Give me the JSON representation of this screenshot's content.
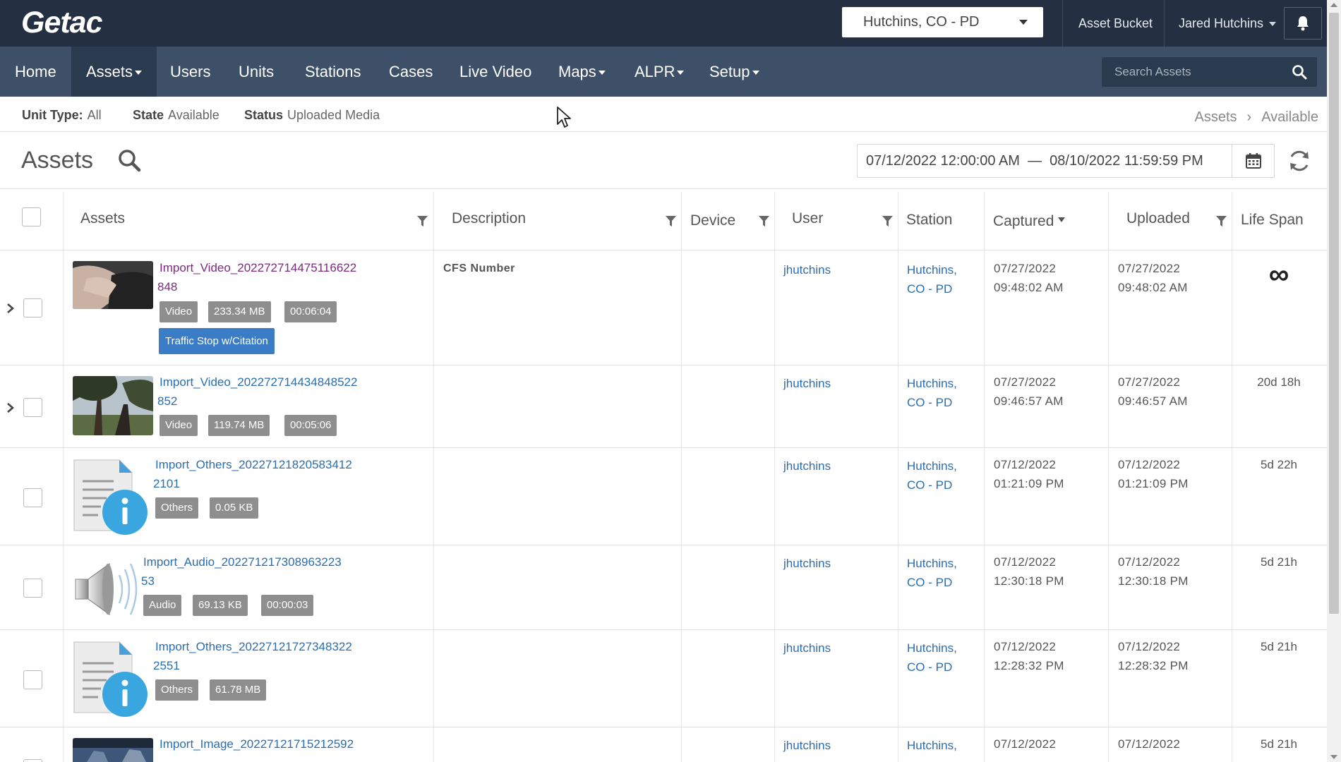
{
  "header": {
    "logo": "Getac",
    "agency": "Hutchins, CO - PD",
    "asset_bucket": "Asset Bucket",
    "user_name": "Jared Hutchins"
  },
  "nav": {
    "items": [
      "Home",
      "Assets",
      "Users",
      "Units",
      "Stations",
      "Cases",
      "Live Video",
      "Maps",
      "ALPR",
      "Setup"
    ],
    "active": "Assets",
    "search_placeholder": "Search Assets"
  },
  "filters": {
    "unit_type_label": "Unit Type:",
    "unit_type_value": "All",
    "state_label": "State",
    "state_value": "Available",
    "status_label": "Status",
    "status_value": "Uploaded Media",
    "breadcrumb": [
      "Assets",
      "Available"
    ]
  },
  "page": {
    "title": "Assets",
    "date_range": "07/12/2022 12:00:00 AM  —  08/10/2022 11:59:59 PM"
  },
  "columns": [
    "Assets",
    "Description",
    "Device",
    "User",
    "Station",
    "Captured",
    "Uploaded",
    "Life Span"
  ],
  "rows": [
    {
      "name_line1": "Import_Video_202272714475116622",
      "name_line2": "848",
      "type": "Video",
      "size": "233.34 MB",
      "duration": "00:06:04",
      "category": "Traffic Stop w/Citation",
      "description": "CFS Number",
      "user": "jhutchins",
      "station_line1": "Hutchins,",
      "station_line2": "CO - PD",
      "captured_date": "07/27/2022",
      "captured_time": "09:48:02 AM",
      "uploaded_date": "07/27/2022",
      "uploaded_time": "09:48:02 AM",
      "life_span": "∞"
    },
    {
      "name_line1": "Import_Video_202272714434848522",
      "name_line2": "852",
      "type": "Video",
      "size": "119.74 MB",
      "duration": "00:05:06",
      "user": "jhutchins",
      "station_line1": "Hutchins,",
      "station_line2": "CO - PD",
      "captured_date": "07/27/2022",
      "captured_time": "09:46:57 AM",
      "uploaded_date": "07/27/2022",
      "uploaded_time": "09:46:57 AM",
      "life_span": "20d 18h"
    },
    {
      "name_line1": "Import_Others_20227121820583412",
      "name_line2": "2101",
      "type": "Others",
      "size": "0.05 KB",
      "user": "jhutchins",
      "station_line1": "Hutchins,",
      "station_line2": "CO - PD",
      "captured_date": "07/12/2022",
      "captured_time": "01:21:09 PM",
      "uploaded_date": "07/12/2022",
      "uploaded_time": "01:21:09 PM",
      "life_span": "5d 22h"
    },
    {
      "name_line1": "Import_Audio_202271217308963223",
      "name_line2": "53",
      "type": "Audio",
      "size": "69.13 KB",
      "duration": "00:00:03",
      "user": "jhutchins",
      "station_line1": "Hutchins,",
      "station_line2": "CO - PD",
      "captured_date": "07/12/2022",
      "captured_time": "12:30:18 PM",
      "uploaded_date": "07/12/2022",
      "uploaded_time": "12:30:18 PM",
      "life_span": "5d 21h"
    },
    {
      "name_line1": "Import_Others_20227121727348322",
      "name_line2": "2551",
      "type": "Others",
      "size": "61.78 MB",
      "user": "jhutchins",
      "station_line1": "Hutchins,",
      "station_line2": "CO - PD",
      "captured_date": "07/12/2022",
      "captured_time": "12:28:32 PM",
      "uploaded_date": "07/12/2022",
      "uploaded_time": "12:28:32 PM",
      "life_span": "5d 21h"
    },
    {
      "name_line1": "Import_Image_20227121715212592",
      "user": "jhutchins",
      "station_line1": "Hutchins,",
      "captured_date": "07/12/2022",
      "uploaded_date": "07/12/2022",
      "life_span": "5d 21h"
    }
  ],
  "icons": {
    "search": "search-icon",
    "bell": "bell-icon",
    "calendar": "calendar-icon",
    "refresh": "refresh-icon",
    "filter": "filter-icon",
    "expand": "chevron-right-icon",
    "infinity": "infinity-icon"
  },
  "colors": {
    "header_bg": "#243041",
    "nav_bg": "#3d5068",
    "nav_active_bg": "#2a3a4f",
    "link": "#2a6eb0",
    "visited_link": "#7b2b7d",
    "tag_bg": "#8e8e8e",
    "category_bg": "#3a7cc5"
  }
}
